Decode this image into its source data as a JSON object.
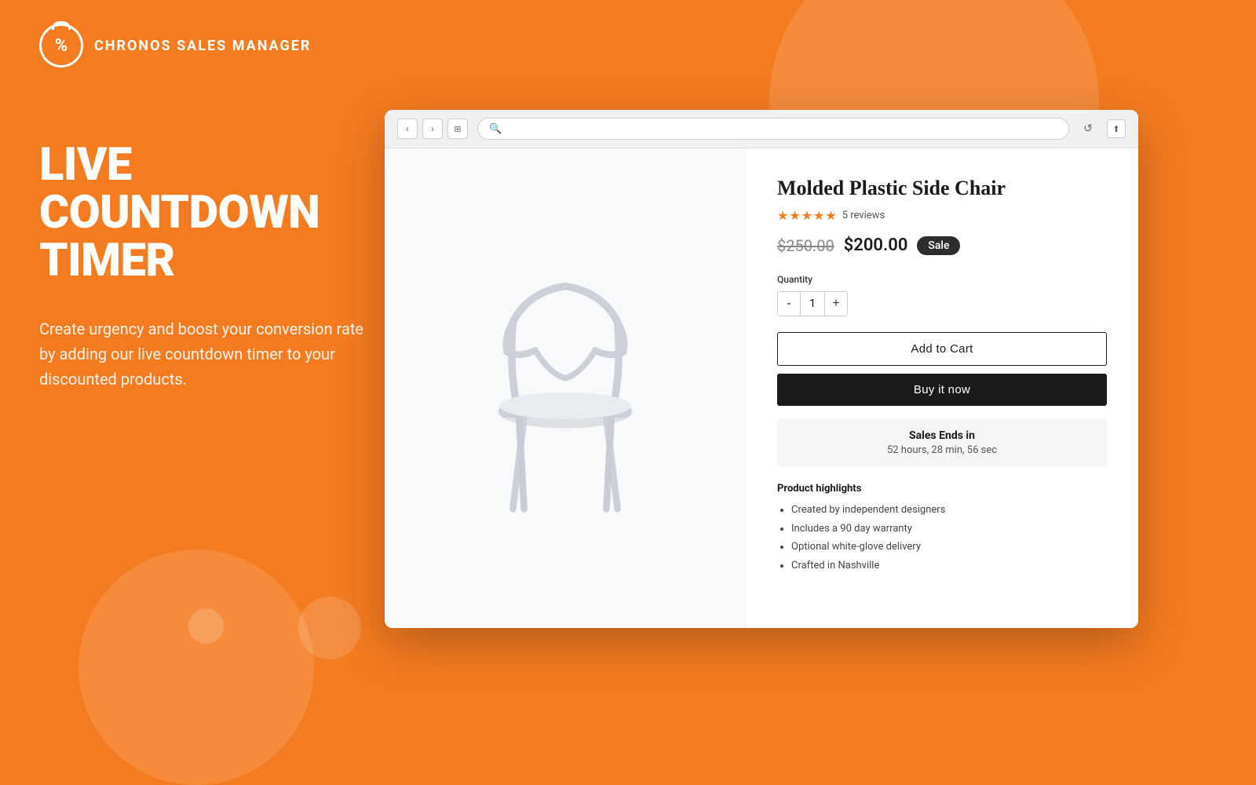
{
  "app": {
    "name": "CHRONOS SALES MANAGER"
  },
  "hero": {
    "headline_line1": "LIVE COUNTDOWN",
    "headline_line2": "TIMER",
    "description": "Create urgency and boost your conversion rate by adding our live countdown timer to your discounted products."
  },
  "browser": {
    "address_placeholder": "🔍",
    "nav": {
      "back": "‹",
      "forward": "›",
      "sidebar": "⊞",
      "reload": "↺",
      "share": "⬆"
    }
  },
  "product": {
    "title": "Molded Plastic Side Chair",
    "stars": "★★★★★",
    "review_count": "5 reviews",
    "original_price": "$250.00",
    "sale_price": "$200.00",
    "sale_badge": "Sale",
    "quantity_label": "Quantity",
    "quantity_value": "1",
    "qty_minus": "-",
    "qty_plus": "+",
    "add_to_cart": "Add to Cart",
    "buy_now": "Buy it now",
    "sales_ends_title": "Sales Ends in",
    "sales_ends_time": "52 hours, 28 min, 56 sec",
    "highlights_title": "Product highlights",
    "highlights": [
      "Created by independent designers",
      "Includes a 90 day warranty",
      "Optional white-glove delivery",
      "Crafted in Nashville"
    ]
  }
}
